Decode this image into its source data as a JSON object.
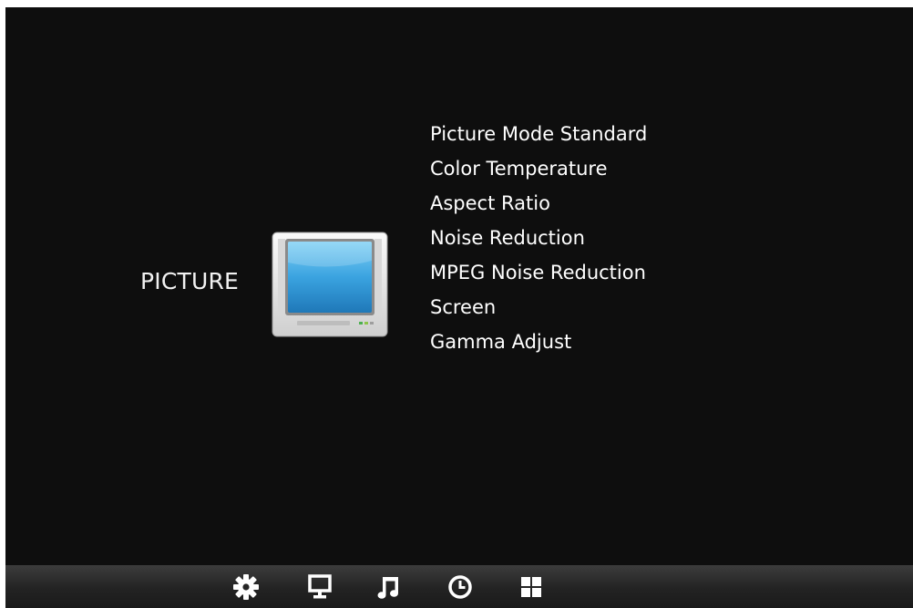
{
  "section": {
    "title": "PICTURE",
    "icon": "tv-icon"
  },
  "menu": {
    "items": [
      {
        "label": "Picture Mode Standard"
      },
      {
        "label": "Color Temperature"
      },
      {
        "label": "Aspect Ratio"
      },
      {
        "label": "Noise Reduction"
      },
      {
        "label": "MPEG Noise Reduction"
      },
      {
        "label": "Screen"
      },
      {
        "label": "Gamma Adjust"
      }
    ]
  },
  "bottom_bar": {
    "icons": [
      "gear-icon",
      "monitor-icon",
      "music-note-icon",
      "clock-icon",
      "grid-icon"
    ]
  },
  "colors": {
    "background": "#0e0e0e",
    "text": "#ffffff",
    "screen_blue": "#3aa3e0",
    "bezel": "#e6e6e6"
  }
}
